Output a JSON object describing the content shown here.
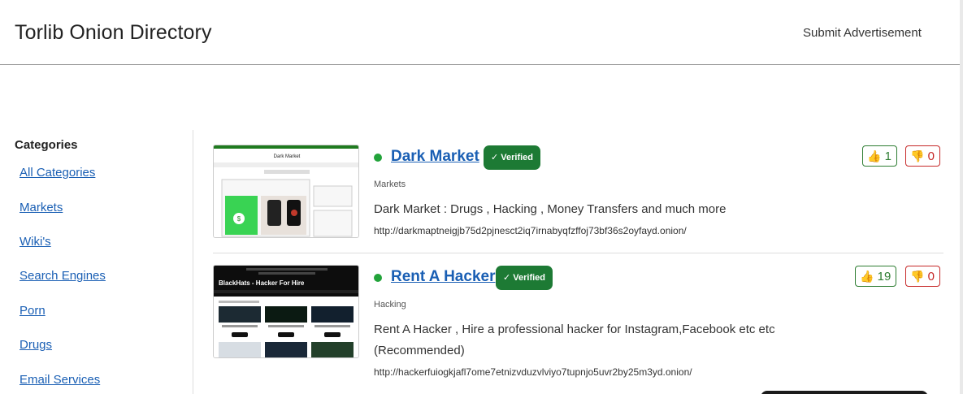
{
  "header": {
    "title": "Torlib Onion Directory",
    "submit_label": "Submit Advertisement"
  },
  "sidebar": {
    "heading": "Categories",
    "items": [
      {
        "label": "All Categories"
      },
      {
        "label": "Markets"
      },
      {
        "label": "Wiki's"
      },
      {
        "label": "Search Engines"
      },
      {
        "label": "Porn"
      },
      {
        "label": "Drugs"
      },
      {
        "label": "Email Services"
      }
    ]
  },
  "listings": [
    {
      "title": "Dark Market",
      "verified_label": "✓ Verified",
      "category": "Markets",
      "description": "Dark Market : Drugs , Hacking , Money Transfers and much more",
      "url": "http://darkmaptneigjb75d2pjnesct2iq7irnabyqfzffoj73bf36s2oyfayd.onion/",
      "upvotes": "1",
      "downvotes": "0",
      "thumb_title": "Dark Market"
    },
    {
      "title": "Rent A Hacker",
      "verified_label": "✓ Verified",
      "category": "Hacking",
      "description": "Rent A Hacker , Hire a professional hacker for Instagram,Facebook etc etc (Recommended)",
      "url": "http://hackerfuiogkjafl7ome7etnizvduzvlviyo7tupnjo5uvr2by25m3yd.onion/",
      "upvotes": "19",
      "downvotes": "0",
      "thumb_title": "BlackHats - Hacker For Hire"
    }
  ],
  "icons": {
    "thumbs_up": "👍",
    "thumbs_down": "👎"
  },
  "colors": {
    "link": "#1a5fb4",
    "verified_bg": "#1d7a34",
    "online": "#22a33a",
    "upvote": "#2e7d32",
    "downvote": "#c62828"
  }
}
